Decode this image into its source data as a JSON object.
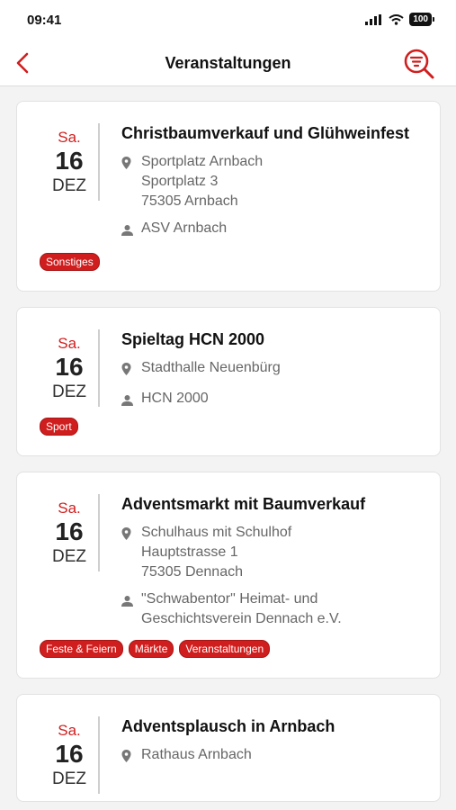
{
  "status_bar": {
    "time": "09:41",
    "battery": "100"
  },
  "nav": {
    "title": "Veranstaltungen"
  },
  "colors": {
    "accent": "#d01e1e"
  },
  "events": [
    {
      "day": "Sa.",
      "date": "16",
      "month": "DEZ",
      "title": "Christbaumverkauf und Glühweinfest",
      "location": [
        "Sportplatz Arnbach",
        "Sportplatz 3",
        "75305 Arnbach"
      ],
      "organizer": [
        "ASV Arnbach"
      ],
      "tags": [
        "Sonstiges"
      ]
    },
    {
      "day": "Sa.",
      "date": "16",
      "month": "DEZ",
      "title": "Spieltag HCN 2000",
      "location": [
        "Stadthalle Neuenbürg"
      ],
      "organizer": [
        "HCN 2000"
      ],
      "tags": [
        "Sport"
      ]
    },
    {
      "day": "Sa.",
      "date": "16",
      "month": "DEZ",
      "title": "Adventsmarkt mit Baumverkauf",
      "location": [
        "Schulhaus mit Schulhof",
        "Hauptstrasse 1",
        "75305 Dennach"
      ],
      "organizer": [
        "\"Schwabentor\" Heimat- und",
        "Geschichtsverein Dennach e.V."
      ],
      "tags": [
        "Feste & Feiern",
        "Märkte",
        "Veranstaltungen"
      ]
    },
    {
      "day": "Sa.",
      "date": "16",
      "month": "DEZ",
      "title": "Adventsplausch in Arnbach",
      "location": [
        "Rathaus Arnbach"
      ],
      "organizer": [],
      "tags": []
    }
  ]
}
